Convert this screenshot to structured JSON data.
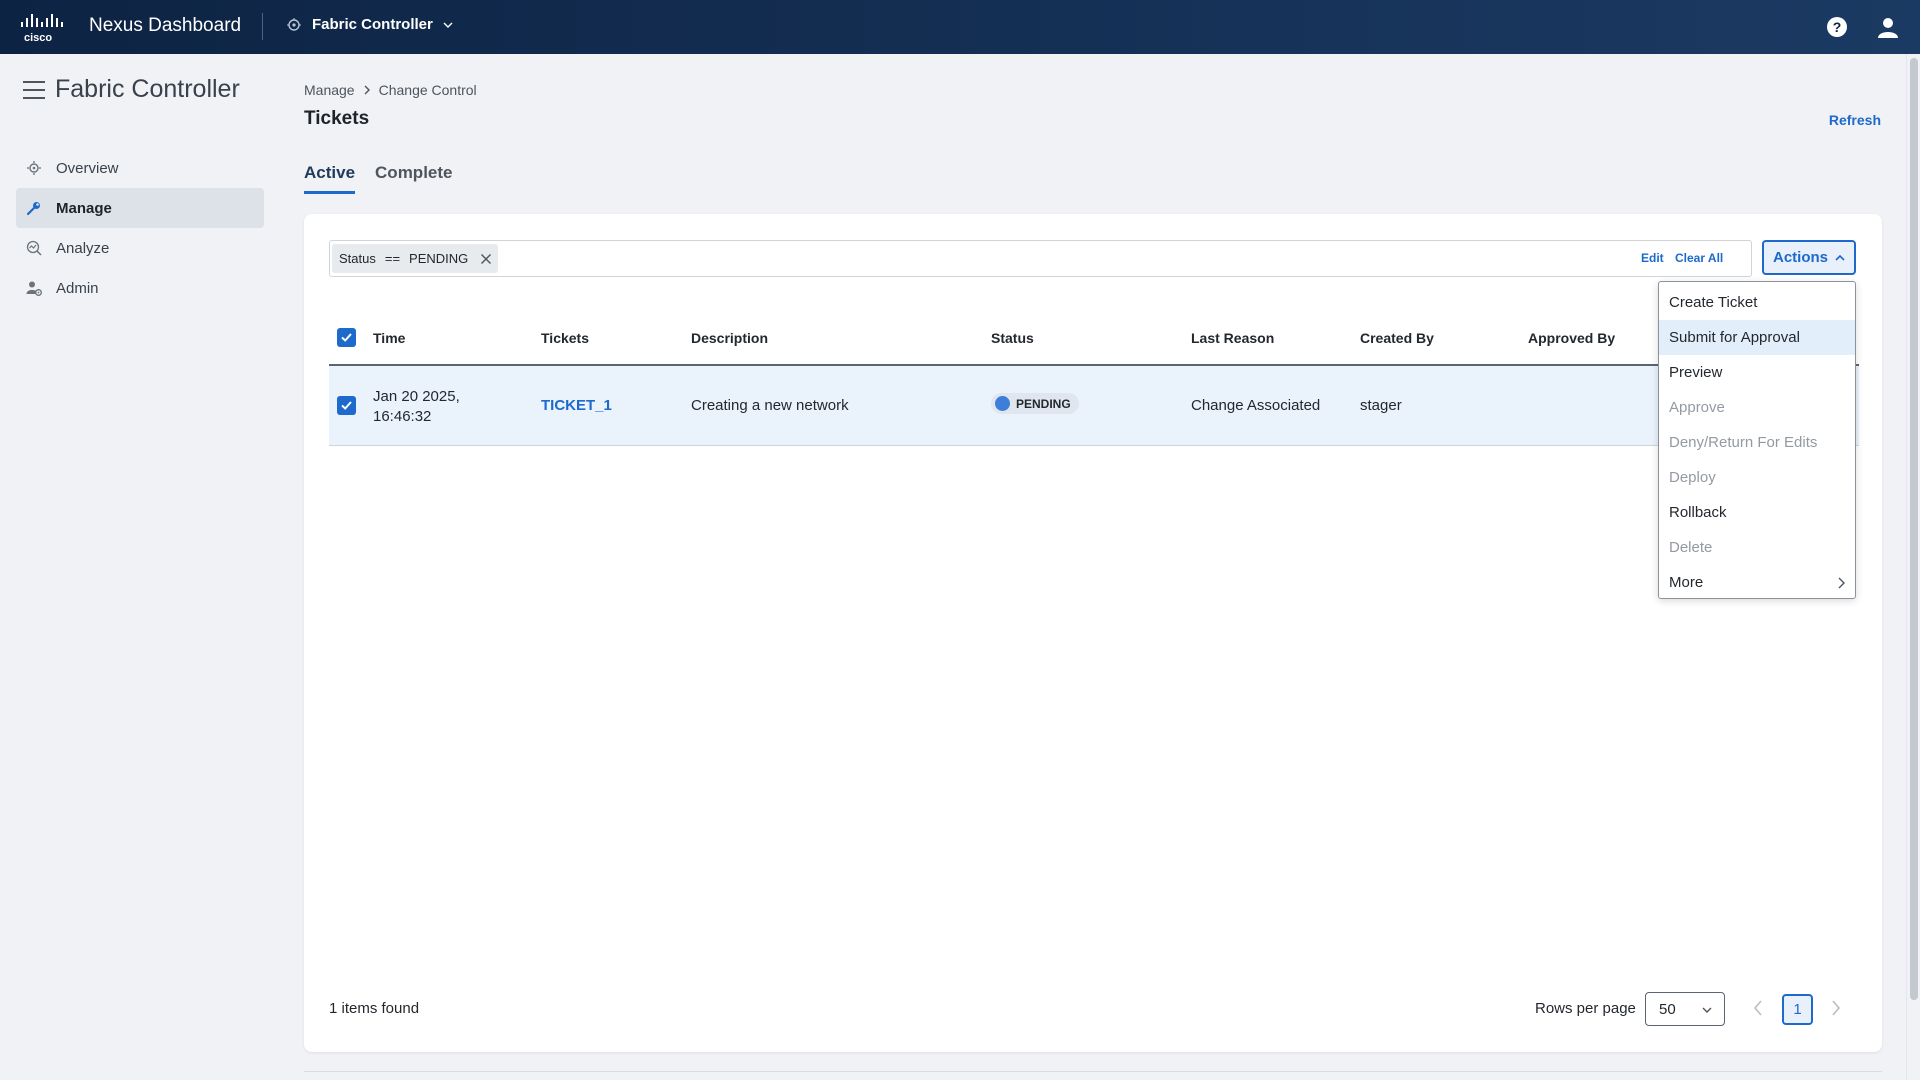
{
  "header": {
    "brand": "cisco",
    "app_title": "Nexus Dashboard",
    "context_switcher": "Fabric Controller",
    "icons": [
      "help-icon",
      "user-icon"
    ]
  },
  "sidebar": {
    "title": "Fabric Controller",
    "items": [
      {
        "label": "Overview",
        "icon": "overview-icon",
        "active": false
      },
      {
        "label": "Manage",
        "icon": "manage-icon",
        "active": true
      },
      {
        "label": "Analyze",
        "icon": "analyze-icon",
        "active": false
      },
      {
        "label": "Admin",
        "icon": "admin-icon",
        "active": false
      }
    ]
  },
  "breadcrumb": [
    "Manage",
    "Change Control"
  ],
  "page": {
    "title": "Tickets",
    "refresh": "Refresh"
  },
  "tabs": [
    {
      "label": "Active",
      "active": true
    },
    {
      "label": "Complete",
      "active": false
    }
  ],
  "filter": {
    "field": "Status",
    "operator": "==",
    "value": "PENDING",
    "edit": "Edit",
    "clear_all": "Clear All"
  },
  "actions": {
    "label": "Actions",
    "menu": [
      {
        "label": "Create Ticket",
        "enabled": true
      },
      {
        "label": "Submit for Approval",
        "enabled": true,
        "highlighted": true
      },
      {
        "label": "Preview",
        "enabled": true
      },
      {
        "label": "Approve",
        "enabled": false
      },
      {
        "label": "Deny/Return For Edits",
        "enabled": false
      },
      {
        "label": "Deploy",
        "enabled": false
      },
      {
        "label": "Rollback",
        "enabled": true
      },
      {
        "label": "Delete",
        "enabled": false
      },
      {
        "label": "More",
        "enabled": true,
        "submenu": true
      }
    ]
  },
  "table": {
    "columns": [
      "Time",
      "Tickets",
      "Description",
      "Status",
      "Last Reason",
      "Created By",
      "Approved By"
    ],
    "rows": [
      {
        "selected": true,
        "time_line1": "Jan 20 2025,",
        "time_line2": "16:46:32",
        "ticket": "TICKET_1",
        "description": "Creating a new network",
        "status": "PENDING",
        "last_reason": "Change Associated",
        "created_by": "stager",
        "approved_by": ""
      }
    ]
  },
  "footer": {
    "items_found": "1 items found",
    "rows_per_page_label": "Rows per page",
    "rows_per_page": "50",
    "current_page": "1"
  },
  "colors": {
    "accent": "#1d69cc",
    "header_bg": "#0d2343",
    "selected_row": "#eaf2fc",
    "status_dot": "#3c7fdb"
  }
}
